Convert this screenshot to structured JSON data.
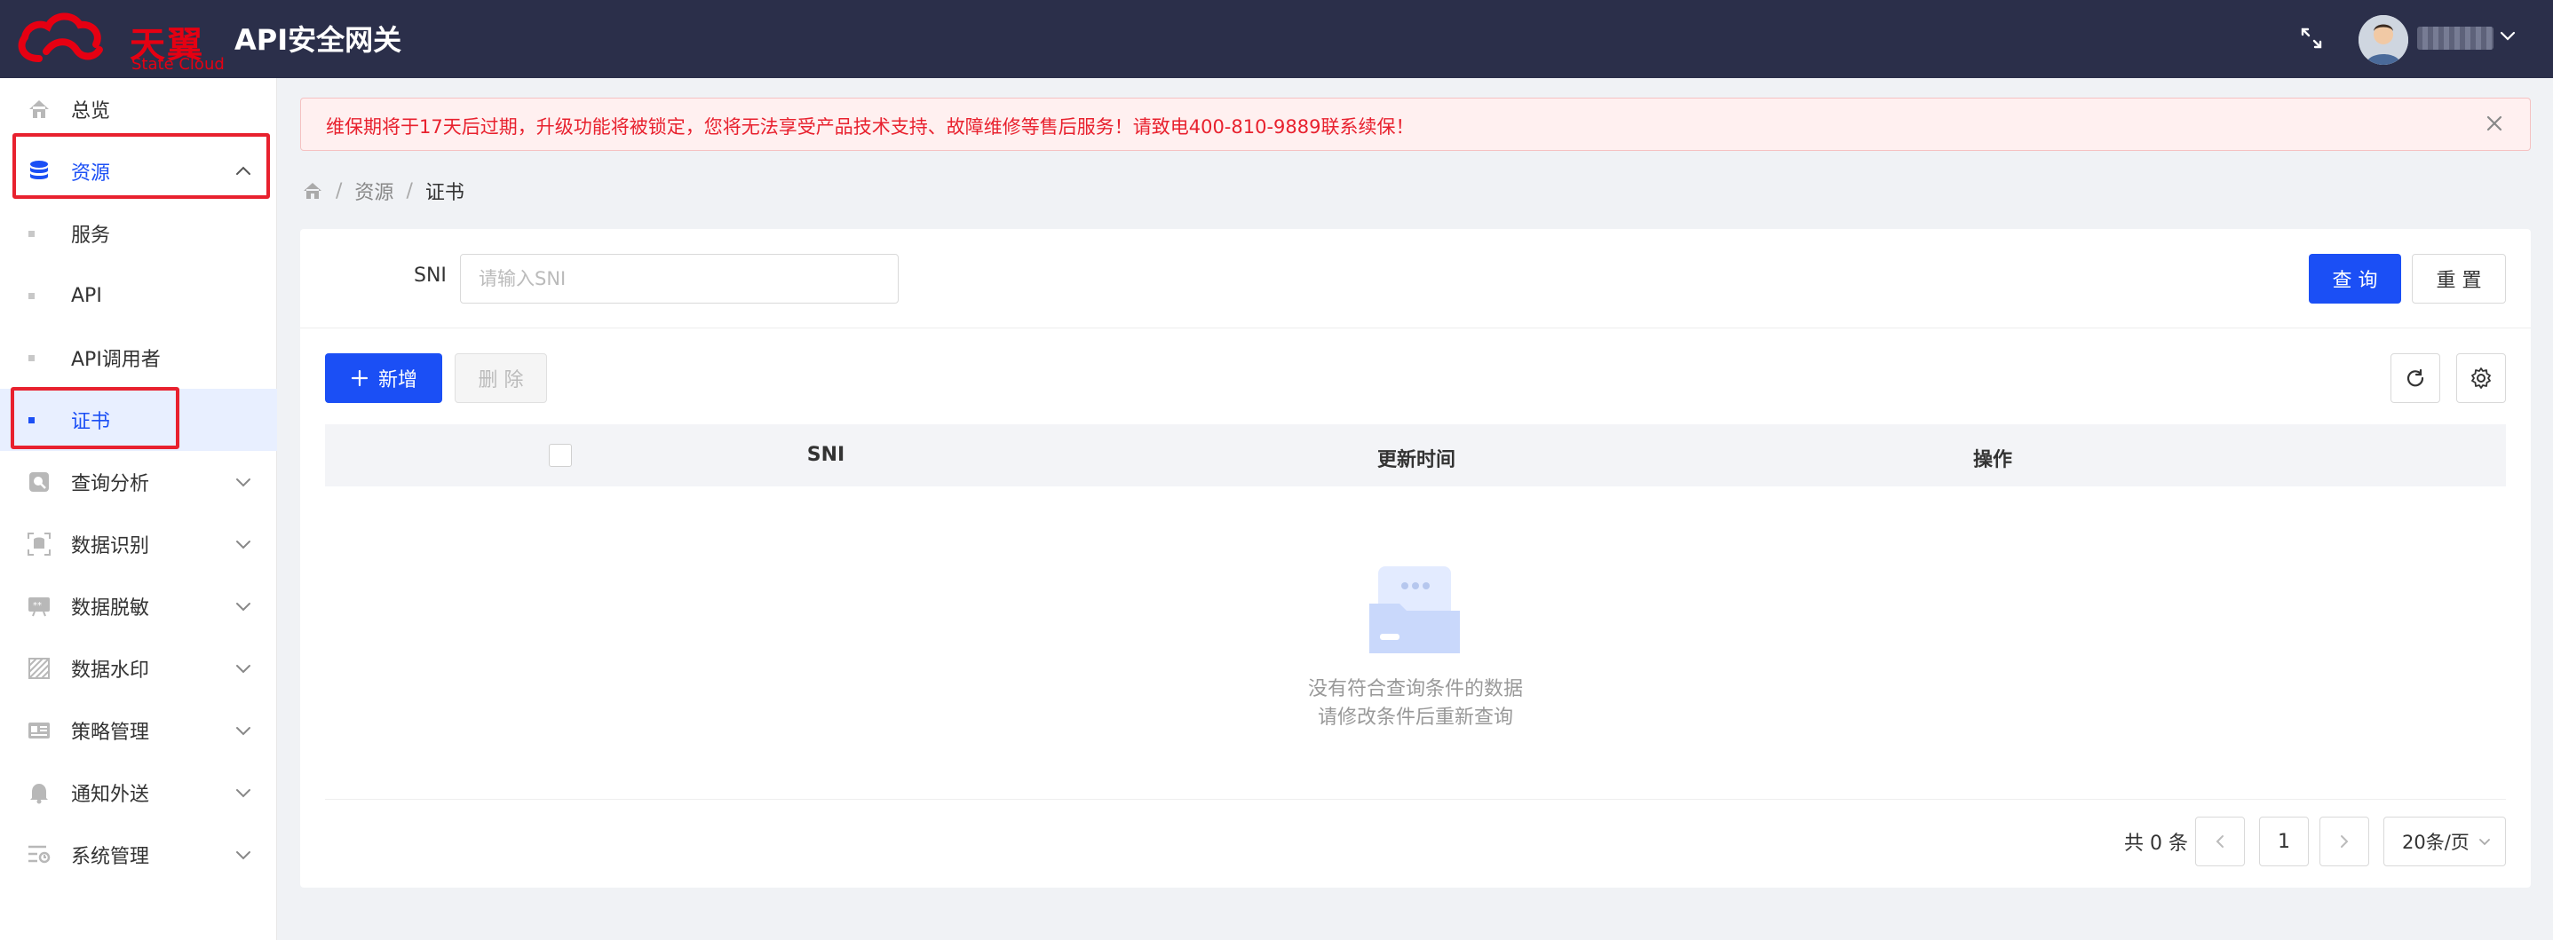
{
  "header": {
    "logo_name": "天翼云",
    "logo_sub": "State Cloud",
    "app_title": "API安全网关",
    "username": "admin"
  },
  "sidebar": {
    "items": [
      {
        "label": "总览",
        "icon": "home-icon"
      },
      {
        "label": "资源",
        "icon": "database-icon"
      },
      {
        "label": "服务"
      },
      {
        "label": "API"
      },
      {
        "label": "API调用者"
      },
      {
        "label": "证书"
      },
      {
        "label": "查询分析",
        "icon": "analysis-icon"
      },
      {
        "label": "数据识别",
        "icon": "data-identify-icon"
      },
      {
        "label": "数据脱敏",
        "icon": "data-mask-icon"
      },
      {
        "label": "数据水印",
        "icon": "watermark-icon"
      },
      {
        "label": "策略管理",
        "icon": "policy-icon"
      },
      {
        "label": "通知外送",
        "icon": "bell-icon"
      },
      {
        "label": "系统管理",
        "icon": "system-icon"
      }
    ]
  },
  "alert": {
    "text": "维保期将于17天后过期，升级功能将被锁定，您将无法享受产品技术支持、故障维修等售后服务！请致电400-810-9889联系续保！"
  },
  "breadcrumb": {
    "level1": "资源",
    "level2": "证书",
    "sep": "/"
  },
  "search": {
    "sni_label": "SNI",
    "sni_placeholder": "请输入SNI",
    "query_label": "查 询",
    "reset_label": "重 置"
  },
  "toolbar": {
    "add_label": "新增",
    "delete_label": "删 除"
  },
  "table": {
    "columns": [
      "SNI",
      "更新时间",
      "操作"
    ],
    "empty_line1": "没有符合查询条件的数据",
    "empty_line2": "请修改条件后重新查询"
  },
  "pagination": {
    "total_text": "共 0 条",
    "current_page": "1",
    "page_size": "20条/页"
  },
  "colors": {
    "primary": "#1b4ff5",
    "header_bg": "#2b2f4a",
    "alert_red": "#e8212e"
  }
}
